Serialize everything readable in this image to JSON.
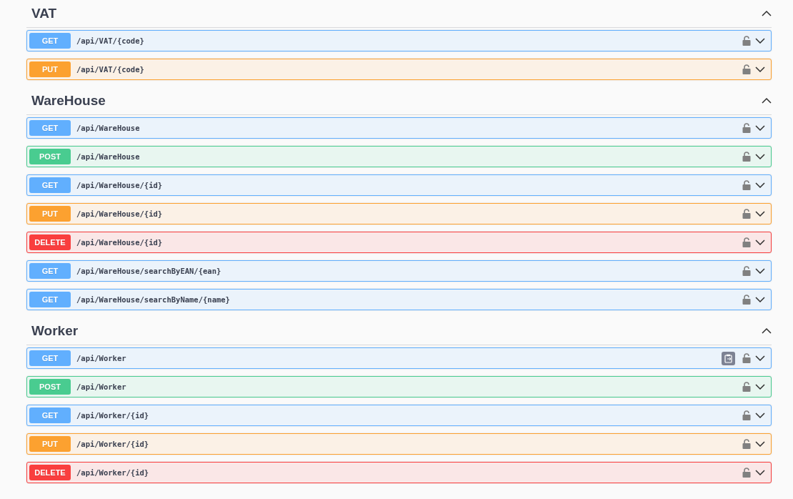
{
  "sections": [
    {
      "title": "VAT",
      "expanded": true,
      "operations": [
        {
          "kind": "get",
          "method": "GET",
          "path": "/api/VAT/{code}",
          "copy_button": false,
          "expanded": false
        },
        {
          "kind": "put",
          "method": "PUT",
          "path": "/api/VAT/{code}",
          "copy_button": false,
          "expanded": false
        }
      ]
    },
    {
      "title": "WareHouse",
      "expanded": true,
      "operations": [
        {
          "kind": "get",
          "method": "GET",
          "path": "/api/WareHouse",
          "copy_button": false,
          "expanded": false
        },
        {
          "kind": "post",
          "method": "POST",
          "path": "/api/WareHouse",
          "copy_button": false,
          "expanded": false
        },
        {
          "kind": "get",
          "method": "GET",
          "path": "/api/WareHouse/{id}",
          "copy_button": false,
          "expanded": false
        },
        {
          "kind": "put",
          "method": "PUT",
          "path": "/api/WareHouse/{id}",
          "copy_button": false,
          "expanded": false
        },
        {
          "kind": "delete",
          "method": "DELETE",
          "path": "/api/WareHouse/{id}",
          "copy_button": false,
          "expanded": false
        },
        {
          "kind": "get",
          "method": "GET",
          "path": "/api/WareHouse/searchByEAN/{ean}",
          "copy_button": false,
          "expanded": false
        },
        {
          "kind": "get",
          "method": "GET",
          "path": "/api/WareHouse/searchByName/{name}",
          "copy_button": false,
          "expanded": false
        }
      ]
    },
    {
      "title": "Worker",
      "expanded": true,
      "operations": [
        {
          "kind": "get",
          "method": "GET",
          "path": "/api/Worker",
          "copy_button": true,
          "expanded": false
        },
        {
          "kind": "post",
          "method": "POST",
          "path": "/api/Worker",
          "copy_button": false,
          "expanded": false
        },
        {
          "kind": "get",
          "method": "GET",
          "path": "/api/Worker/{id}",
          "copy_button": false,
          "expanded": false
        },
        {
          "kind": "put",
          "method": "PUT",
          "path": "/api/Worker/{id}",
          "copy_button": false,
          "expanded": false
        },
        {
          "kind": "delete",
          "method": "DELETE",
          "path": "/api/Worker/{id}",
          "copy_button": false,
          "expanded": false
        }
      ]
    }
  ]
}
